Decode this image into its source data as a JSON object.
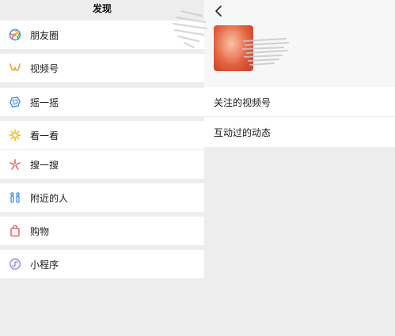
{
  "left": {
    "title": "发现",
    "items": [
      {
        "label": "朋友圈",
        "icon": "moments-icon"
      },
      {
        "label": "视频号",
        "icon": "channels-icon"
      },
      {
        "label": "摇一摇",
        "icon": "shake-icon"
      },
      {
        "label": "看一看",
        "icon": "top-stories-icon"
      },
      {
        "label": "搜一搜",
        "icon": "search-icon"
      },
      {
        "label": "附近的人",
        "icon": "people-nearby-icon"
      },
      {
        "label": "购物",
        "icon": "shopping-bag-icon"
      },
      {
        "label": "小程序",
        "icon": "mini-program-icon"
      }
    ]
  },
  "right": {
    "back_glyph": "‹",
    "items": [
      {
        "label": "关注的视频号"
      },
      {
        "label": "互动过的动态"
      }
    ]
  },
  "colors": {
    "background": "#ededed",
    "row": "#ffffff",
    "text": "#1a1a1a",
    "channels_orange": "#f0a020"
  }
}
